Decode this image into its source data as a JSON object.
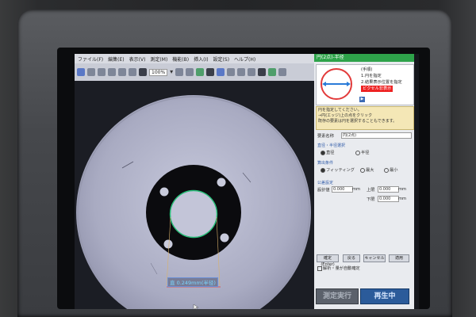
{
  "menu": {
    "items": [
      "ファイル(F)",
      "編集(E)",
      "表示(V)",
      "測定(M)",
      "機能(B)",
      "挿入(I)",
      "設定(S)",
      "ヘルプ(H)"
    ]
  },
  "toolbar": {
    "zoom": "100%"
  },
  "panel": {
    "title": "円(2点)-半径",
    "guide": {
      "steps_header": "(手順)",
      "step1": "1.円を指定",
      "step2": "2.結果表示位置を指定",
      "warning": "ピクセル非表示"
    },
    "note_line1": "円を指定してください。",
    "note_line2": "→円(エッジ)上の点をクリック",
    "note_line3": "既存の要素は円を選択することもできます。",
    "name_label": "要素名称",
    "name_value": "円(2点)",
    "select_label": "直径・半径選択",
    "opt_diameter": "直径",
    "opt_radius": "半径",
    "calc_label": "算出条件",
    "opt_fitting": "フィッティング",
    "opt_max": "最大",
    "opt_min": "最小",
    "tol_label": "公差設定",
    "design_label": "設計値",
    "design_value": "0.000",
    "upper_label": "上限",
    "upper_value": "0.000",
    "lower_label": "下限",
    "lower_value": "0.000",
    "unit": "mm",
    "btn_register": "確定(Enter)",
    "btn_back": "戻る",
    "btn_cancel": "キャンセル",
    "btn_apply": "適用",
    "auto_check": "解析・量が自動確定",
    "btn_measure": "測定実行",
    "btn_play": "再生中"
  },
  "measurement": {
    "label": "直 0.249mm(半径)"
  },
  "colors": {
    "panel_title": "#2ea34a",
    "circle_overlay": "#27c27a",
    "arrow": "#2a7bd8",
    "warning": "#e22222"
  }
}
